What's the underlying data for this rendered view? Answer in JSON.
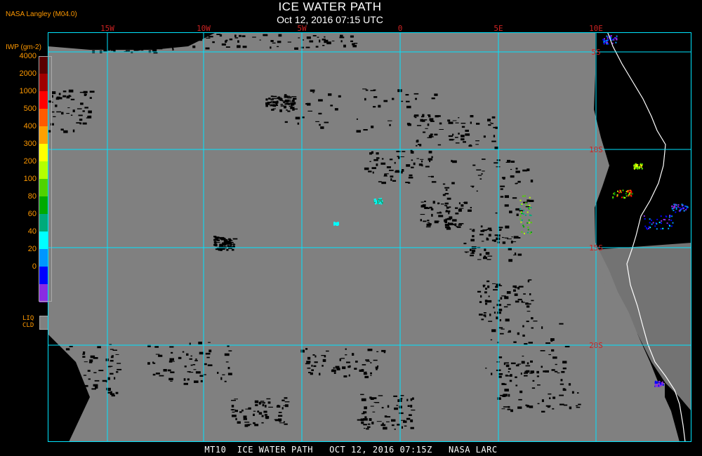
{
  "header": {
    "title": "ICE WATER PATH",
    "datetime": "Oct 12, 2016 07:15 UTC",
    "source": "NASA Langley (M04.0)"
  },
  "legend": {
    "unit": "IWP (gm-2)",
    "levels": [
      {
        "label": "4000",
        "color": "#5a0000"
      },
      {
        "label": "2000",
        "color": "#a00000"
      },
      {
        "label": "1000",
        "color": "#ff0000"
      },
      {
        "label": "500",
        "color": "#ff5a00"
      },
      {
        "label": "400",
        "color": "#ffa000"
      },
      {
        "label": "300",
        "color": "#ffff00"
      },
      {
        "label": "200",
        "color": "#b4ff00"
      },
      {
        "label": "100",
        "color": "#50d200"
      },
      {
        "label": "80",
        "color": "#00aa00"
      },
      {
        "label": "60",
        "color": "#00aa7a"
      },
      {
        "label": "40",
        "color": "#00ffff"
      },
      {
        "label": "20",
        "color": "#0096ff"
      },
      {
        "label": "0",
        "color": "#0000ff"
      },
      {
        "label": "",
        "color": "#8a2be2"
      }
    ],
    "liq_label_1": "LIQ",
    "liq_label_2": "CLD",
    "liq_color": "#808080"
  },
  "map": {
    "lon_labels": [
      "15W",
      "10W",
      "5W",
      "0",
      "5E",
      "10E"
    ],
    "lat_labels": [
      "5S",
      "10S",
      "15S",
      "20S"
    ],
    "colors": {
      "grid": "#00e5ff",
      "coast": "#ffffff",
      "background": "#808080",
      "clear": "#000000",
      "labels": "#cc2222"
    }
  },
  "footer": {
    "text": "MT10  ICE WATER PATH   OCT 12, 2016 07:15Z   NASA LARC"
  }
}
